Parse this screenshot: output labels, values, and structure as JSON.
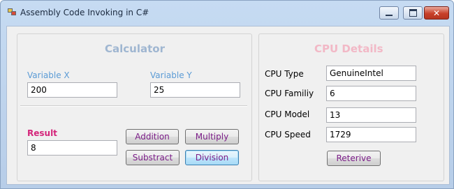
{
  "window": {
    "title": "Assembly Code Invoking in C#",
    "controls": {
      "minimize": "minimize-icon",
      "maximize": "maximize-icon",
      "close": "✕"
    }
  },
  "calculator": {
    "heading": "Calculator",
    "variable_x_label": "Variable X",
    "variable_x_value": "200",
    "variable_y_label": "Variable Y",
    "variable_y_value": "25",
    "result_label": "Result",
    "result_value": "8",
    "buttons": {
      "addition": "Addition",
      "multiply": "Multiply",
      "subtract": "Substract",
      "division": "Division"
    }
  },
  "cpu": {
    "heading": "CPU Details",
    "type_label": "CPU Type",
    "type_value": "GenuineIntel",
    "family_label": "CPU Familiy",
    "family_value": "6",
    "model_label": "CPU Model",
    "model_value": "13",
    "speed_label": "CPU Speed",
    "speed_value": "1729",
    "retrieve_button": "Reterive"
  },
  "colors": {
    "calculator_heading": "#9fb6d1",
    "cpu_heading": "#f2b8c6",
    "variable_label": "#5b9bd5",
    "result_label": "#d4257a",
    "button_text": "#7a1c87"
  }
}
